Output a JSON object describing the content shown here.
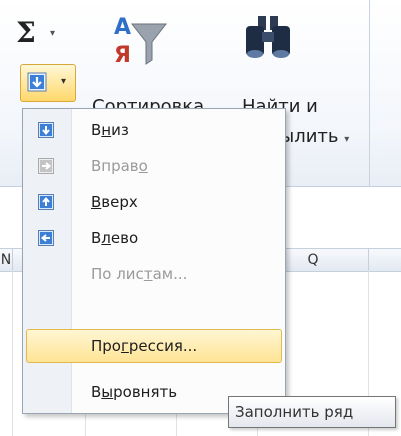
{
  "ribbon": {
    "autosum_symbol": "Σ",
    "dropdown_glyph": "▾",
    "sort_label": "Сортировка",
    "find_label_line1": "Найти и",
    "find_label_line2": "ылить"
  },
  "sheet": {
    "columns": [
      {
        "label": "N"
      },
      {
        "label": ""
      },
      {
        "label": ""
      },
      {
        "label": ""
      },
      {
        "label": "Q"
      },
      {
        "label": ""
      }
    ]
  },
  "menu": {
    "items": [
      {
        "pre": "В",
        "mn": "н",
        "post": "из",
        "icon": "arrow-down-icon",
        "enabled": true
      },
      {
        "pre": "Вправ",
        "mn": "о",
        "post": "",
        "icon": "arrow-right-icon",
        "enabled": false
      },
      {
        "pre": "",
        "mn": "В",
        "post": "верх",
        "icon": "arrow-up-icon",
        "enabled": true
      },
      {
        "pre": "В",
        "mn": "л",
        "post": "ево",
        "icon": "arrow-left-icon",
        "enabled": true
      },
      {
        "pre": "По лис",
        "mn": "т",
        "post": "ам...",
        "icon": "",
        "enabled": false
      },
      {
        "pre": "Про",
        "mn": "г",
        "post": "рессия...",
        "icon": "",
        "enabled": true,
        "highlighted": true
      },
      {
        "pre": "В",
        "mn": "ы",
        "post": "ровнять",
        "icon": "",
        "enabled": true
      }
    ]
  },
  "tooltip": {
    "text": "Заполнить ряд"
  },
  "colors": {
    "accent_blue": "#2f6fc7",
    "highlight": "#ffe496"
  }
}
